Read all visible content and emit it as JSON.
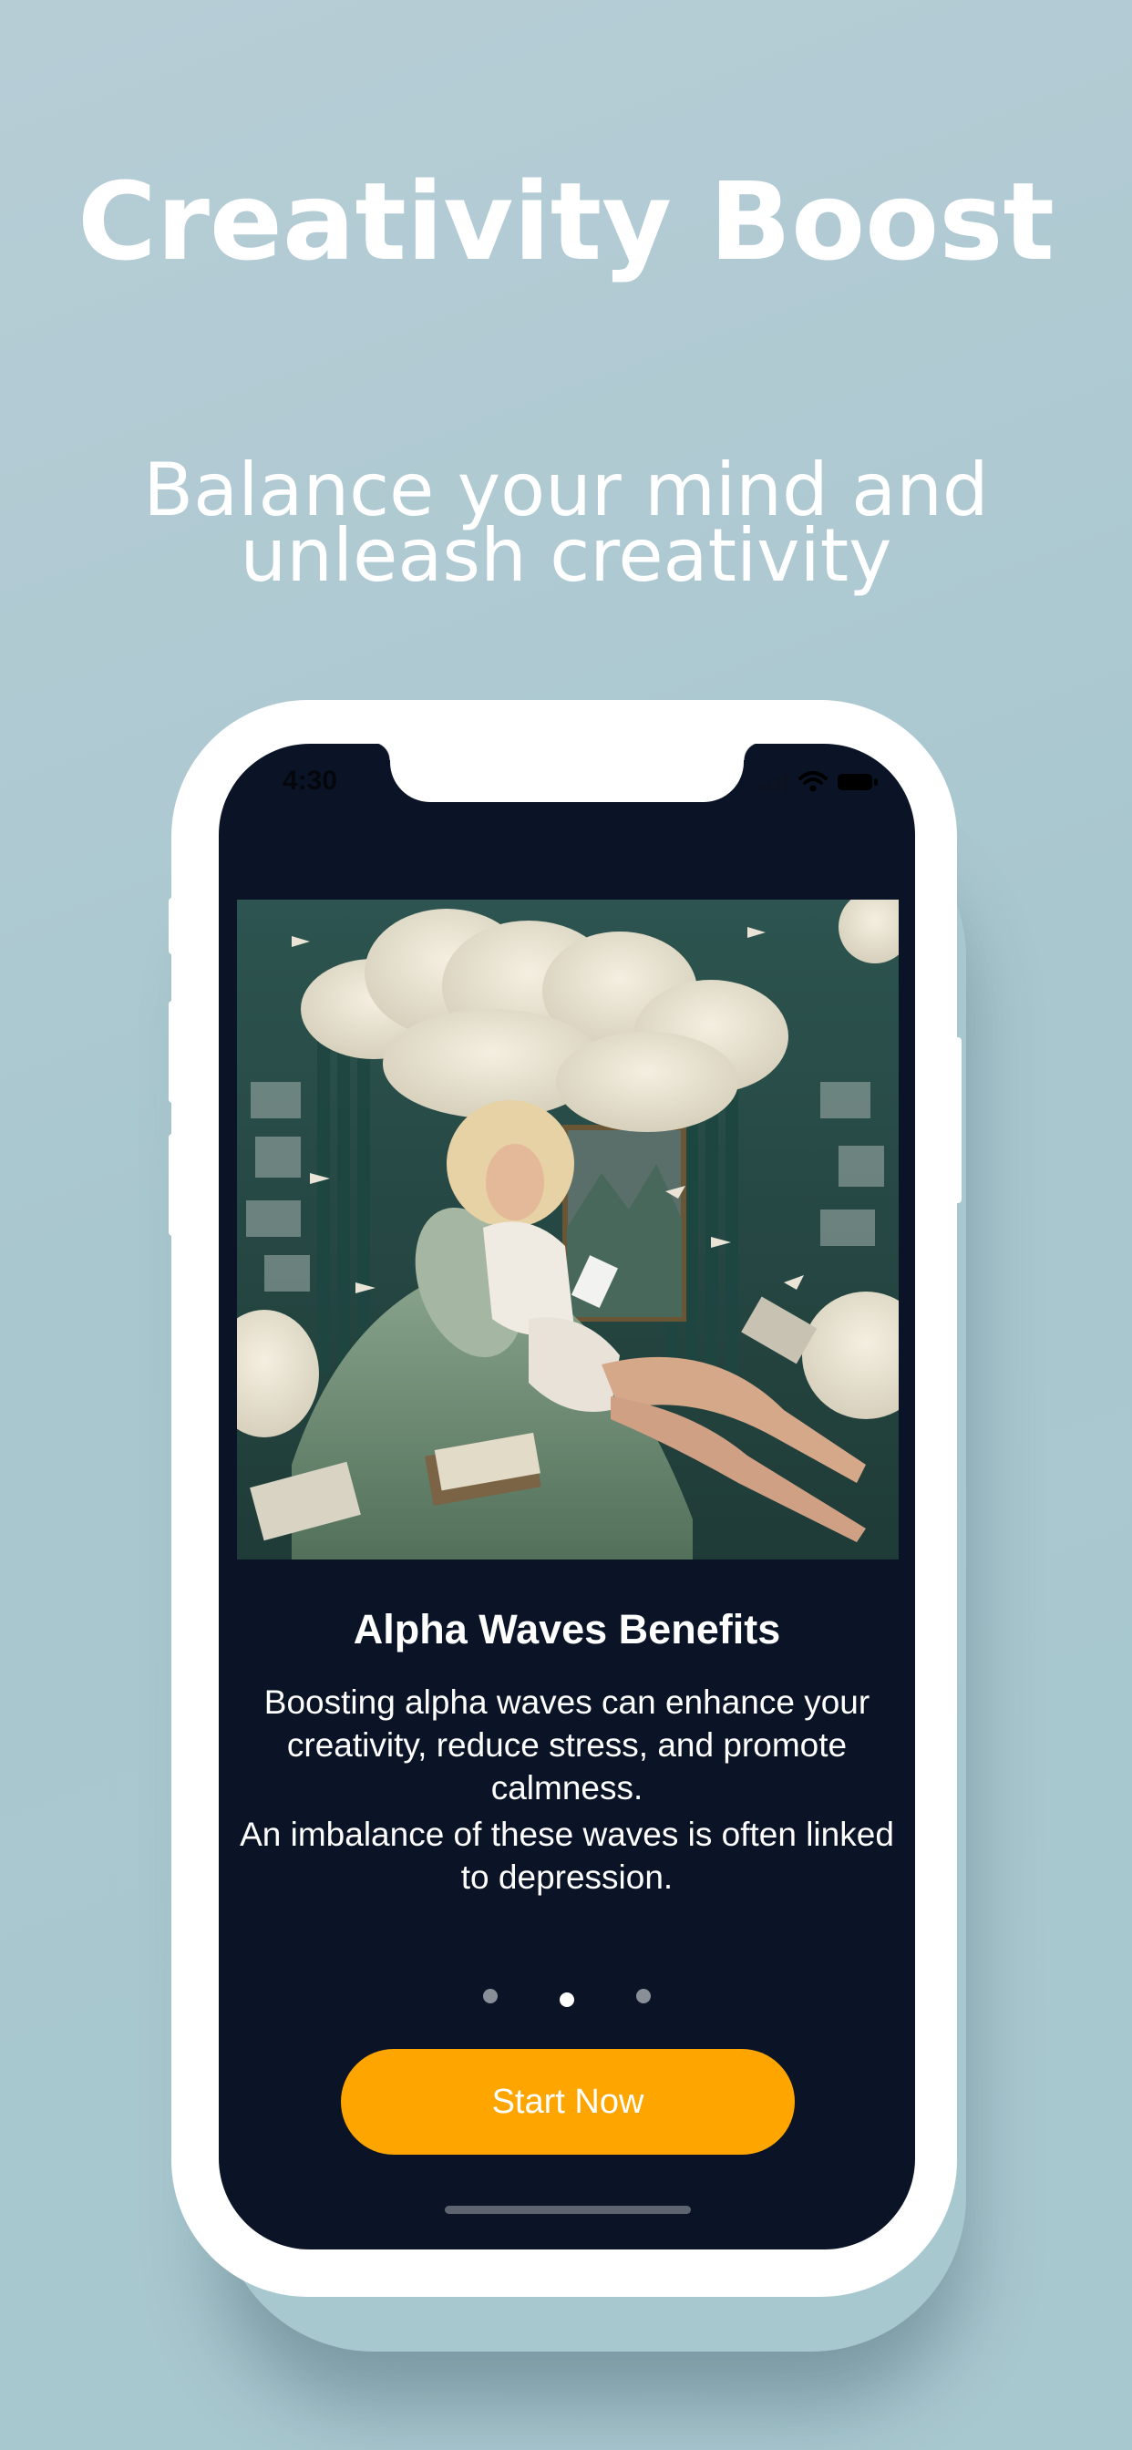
{
  "marketing": {
    "headline": "Creativity Boost",
    "subheadline_line1": "Balance your mind and",
    "subheadline_line2": "unleash creativity"
  },
  "status_bar": {
    "time": "4:30",
    "icons": [
      "signal-icon",
      "wifi-icon",
      "battery-icon"
    ]
  },
  "onboarding": {
    "title": "Alpha Waves Benefits",
    "body_line1": "Boosting alpha waves can enhance your",
    "body_line2": "creativity, reduce stress, and promote",
    "body_line3": "calmness.",
    "body2_line1": "An imbalance of these waves is often linked",
    "body2_line2": "to depression.",
    "page_count": 3,
    "active_page": 2,
    "cta_label": "Start Now"
  },
  "colors": {
    "background": "#a9c7cf",
    "screen": "#0b1427",
    "accent": "#ffa500",
    "text": "#ffffff"
  }
}
